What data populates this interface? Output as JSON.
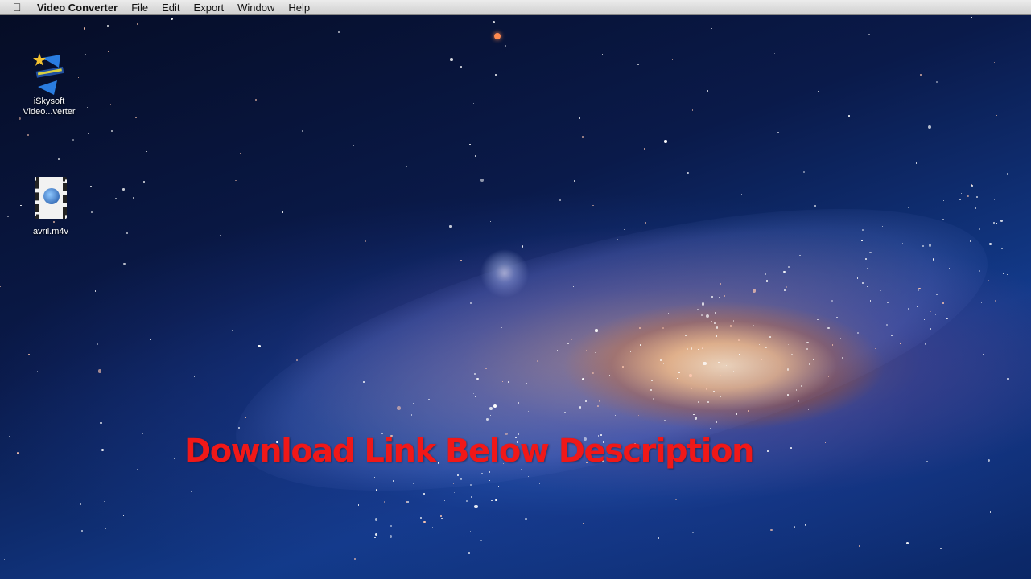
{
  "menubar": {
    "apple_icon": "apple-logo-icon",
    "app_name": "Video Converter",
    "items": [
      "File",
      "Edit",
      "Export",
      "Window",
      "Help"
    ]
  },
  "desktop": {
    "icons": [
      {
        "label_line1": "iSkysoft",
        "label_line2": "Video...verter",
        "icon": "app-icon"
      },
      {
        "label_line1": "avril.m4v",
        "icon": "video-file-icon"
      }
    ]
  },
  "overlay_text": "Download Link Below Description"
}
